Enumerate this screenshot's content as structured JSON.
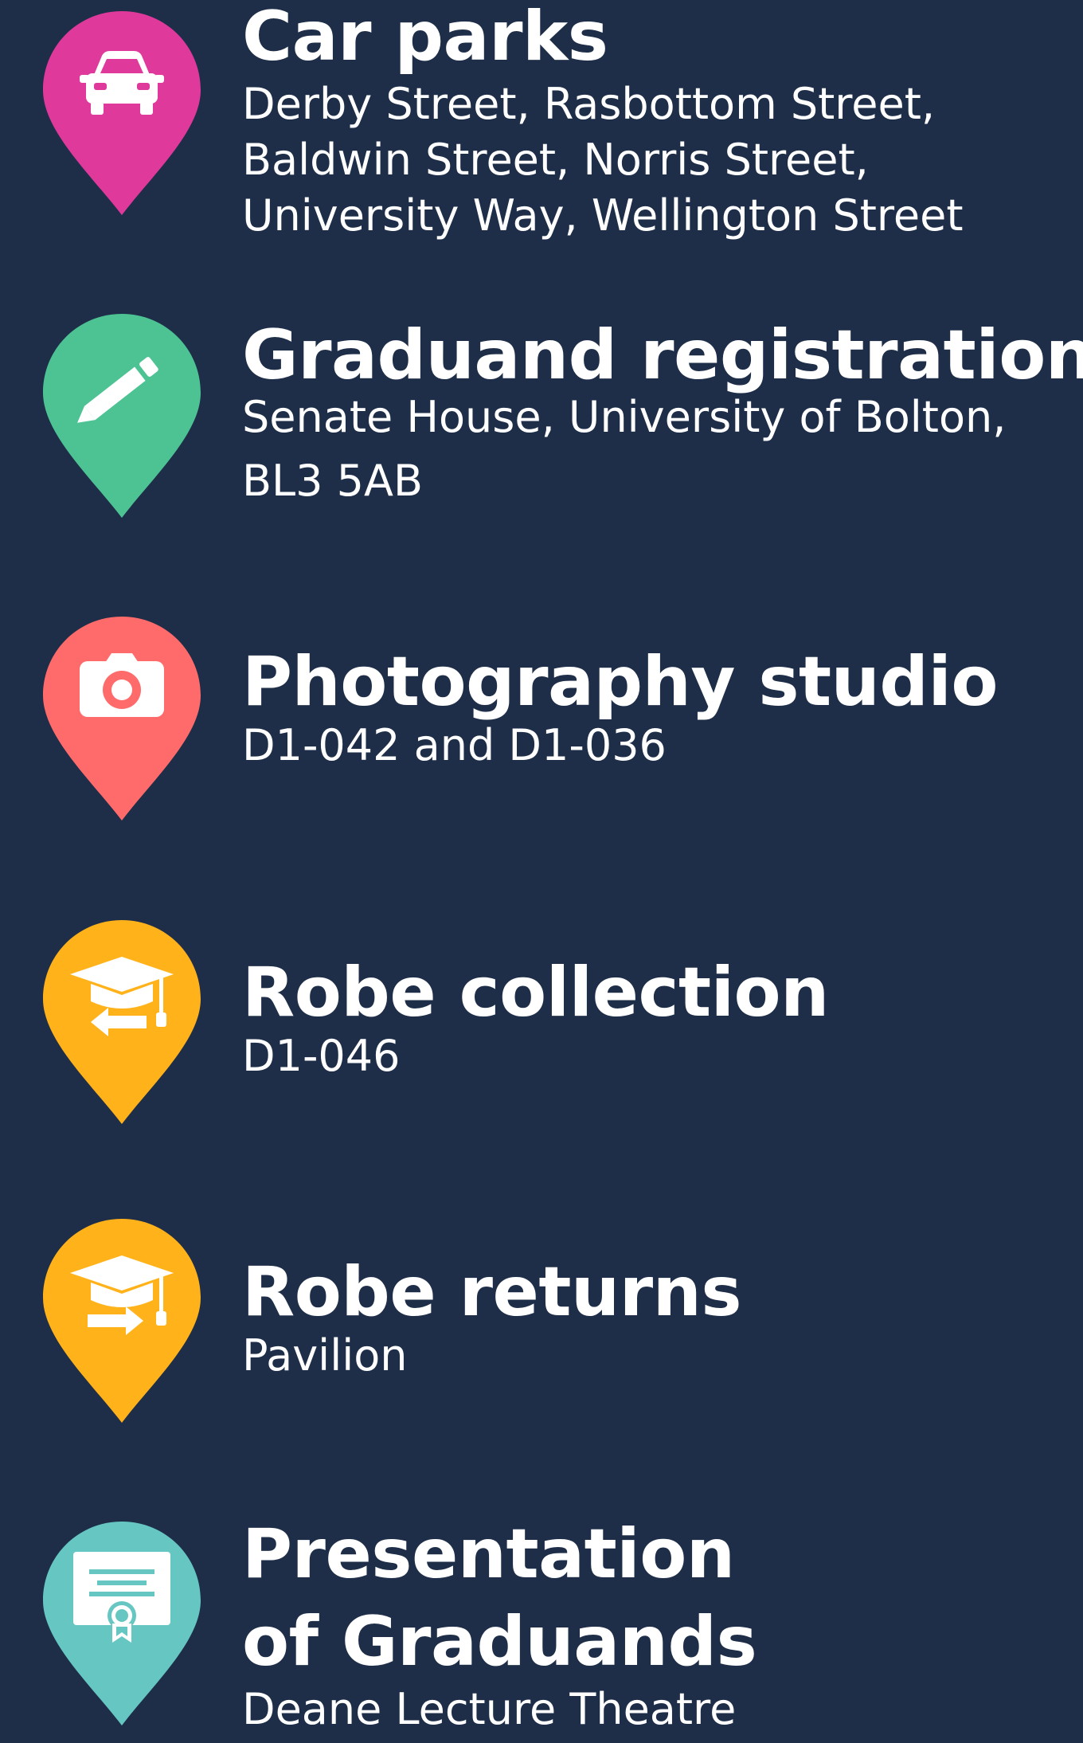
{
  "colors": {
    "background": "#1e2e48",
    "car_parks": "#e0399c",
    "registration": "#4dc394",
    "photography": "#ff6b6b",
    "robe": "#ffb21a",
    "presentation": "#66c7c2"
  },
  "entries": [
    {
      "icon": "car-icon",
      "title": "Car parks",
      "details": [
        "Derby Street, Rasbottom Street,",
        "Baldwin Street, Norris Street,",
        "University Way, Wellington Street"
      ]
    },
    {
      "icon": "pencil-icon",
      "title": "Graduand registration",
      "details": [
        "Senate House, University of Bolton,",
        "BL3 5AB"
      ]
    },
    {
      "icon": "camera-icon",
      "title": "Photography studio",
      "details": [
        "D1-042 and D1-036"
      ]
    },
    {
      "icon": "graduation-cap-arrow-left-icon",
      "title": "Robe collection",
      "details": [
        "D1-046"
      ]
    },
    {
      "icon": "graduation-cap-arrow-right-icon",
      "title": "Robe returns",
      "details": [
        "Pavilion"
      ]
    },
    {
      "icon": "certificate-icon",
      "title_lines": [
        "Presentation",
        "of Graduands"
      ],
      "details": [
        "Deane Lecture Theatre"
      ]
    }
  ]
}
